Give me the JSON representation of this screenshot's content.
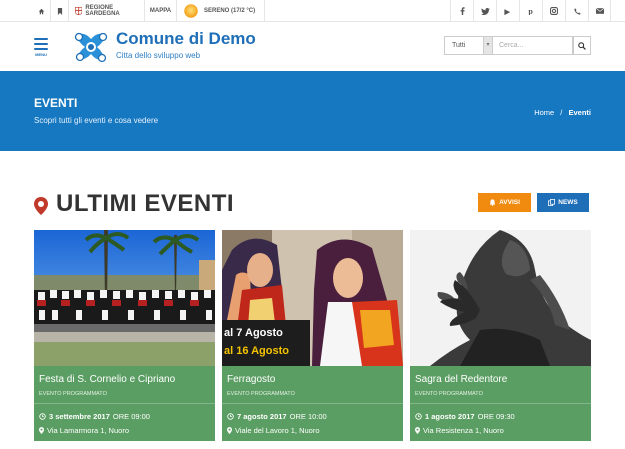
{
  "topbar": {
    "region_label": "REGIONE SARDEGNA",
    "map_label": "MAPPA",
    "weather_label": "SERENO (17/2 °C)"
  },
  "header": {
    "menu_label": "MENU",
    "site_title": "Comune di Demo",
    "site_subtitle": "Citta dello sviluppo web",
    "search": {
      "select_value": "Tutti",
      "placeholder": "Cerca..."
    }
  },
  "banner": {
    "title": "EVENTI",
    "subtitle": "Scopri tutti gli eventi e cosa vedere",
    "breadcrumb": {
      "home": "Home",
      "separator": "/",
      "current": "Eventi"
    }
  },
  "section": {
    "title": "ULTIMI EVENTI",
    "avvisi_label": "AVVISI",
    "news_label": "NEWS"
  },
  "colors": {
    "primary": "#1778c2",
    "accent_orange": "#f18b0f",
    "card_green": "#5b9e63",
    "pin_red": "#c0392b"
  },
  "events": [
    {
      "title": "Festa di S. Cornelio e Cipriano",
      "type": "EVENTO PROGRAMMATO",
      "date": "3 settembre 2017",
      "time": "ORE 09:00",
      "address": "Via Lamarmora 1, Nuoro",
      "image_caption": ""
    },
    {
      "title": "Ferragosto",
      "type": "EVENTO PROGRAMMATO",
      "date": "7 agosto 2017",
      "time": "ORE 10:00",
      "address": "Viale del Lavoro 1, Nuoro",
      "image_caption_1": "al 7 Agosto",
      "image_caption_2": "al 16 Agosto"
    },
    {
      "title": "Sagra del Redentore",
      "type": "EVENTO PROGRAMMATO",
      "date": "1 agosto 2017",
      "time": "ORE 09:30",
      "address": "Via Resistenza 1, Nuoro"
    }
  ]
}
